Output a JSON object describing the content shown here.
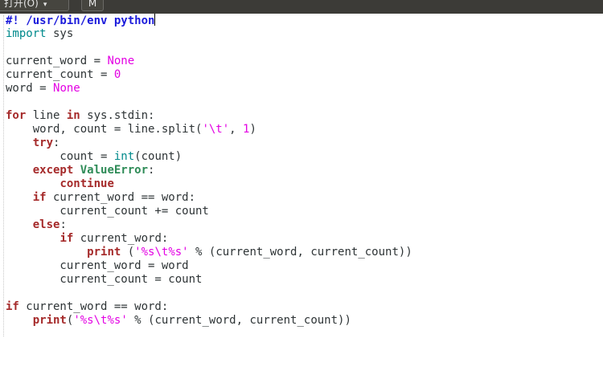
{
  "toolbar": {
    "open_label": "打开(O)",
    "menu_label": "M"
  },
  "code": {
    "l1_shebang": "#! /usr/bin/env python",
    "l2_import": "import",
    "l2_module": " sys",
    "l4_name": "current_word = ",
    "l4_value": "None",
    "l5_name": "current_count = ",
    "l5_value": "0",
    "l6_name": "word = ",
    "l6_value": "None",
    "l8_for": "for",
    "l8_mid": " line ",
    "l8_in": "in",
    "l8_rest": " sys.stdin:",
    "l9_a": "    word, count = line.split(",
    "l9_str": "'\\t'",
    "l9_b": ", ",
    "l9_num": "1",
    "l9_c": ")",
    "l10_ind": "    ",
    "l10_try": "try",
    "l10_colon": ":",
    "l11_a": "        count = ",
    "l11_int": "int",
    "l11_b": "(count)",
    "l12_ind": "    ",
    "l12_except": "except",
    "l12_sp": " ",
    "l12_err": "ValueError",
    "l12_colon": ":",
    "l13_ind": "        ",
    "l13_cont": "continue",
    "l14_ind": "    ",
    "l14_if": "if",
    "l14_rest": " current_word == word:",
    "l15_text": "        current_count += count",
    "l16_ind": "    ",
    "l16_else": "else",
    "l16_colon": ":",
    "l17_ind": "        ",
    "l17_if": "if",
    "l17_rest": " current_word:",
    "l18_ind": "            ",
    "l18_print": "print",
    "l18_a": " (",
    "l18_str": "'%s\\t%s'",
    "l18_b": " % (current_word, current_count))",
    "l19_text": "        current_word = word",
    "l20_text": "        current_count = count",
    "l22_if": "if",
    "l22_rest": " current_word == word:",
    "l23_ind": "    ",
    "l23_print": "print",
    "l23_a": "(",
    "l23_str": "'%s\\t%s'",
    "l23_b": " % (current_word, current_count))"
  }
}
